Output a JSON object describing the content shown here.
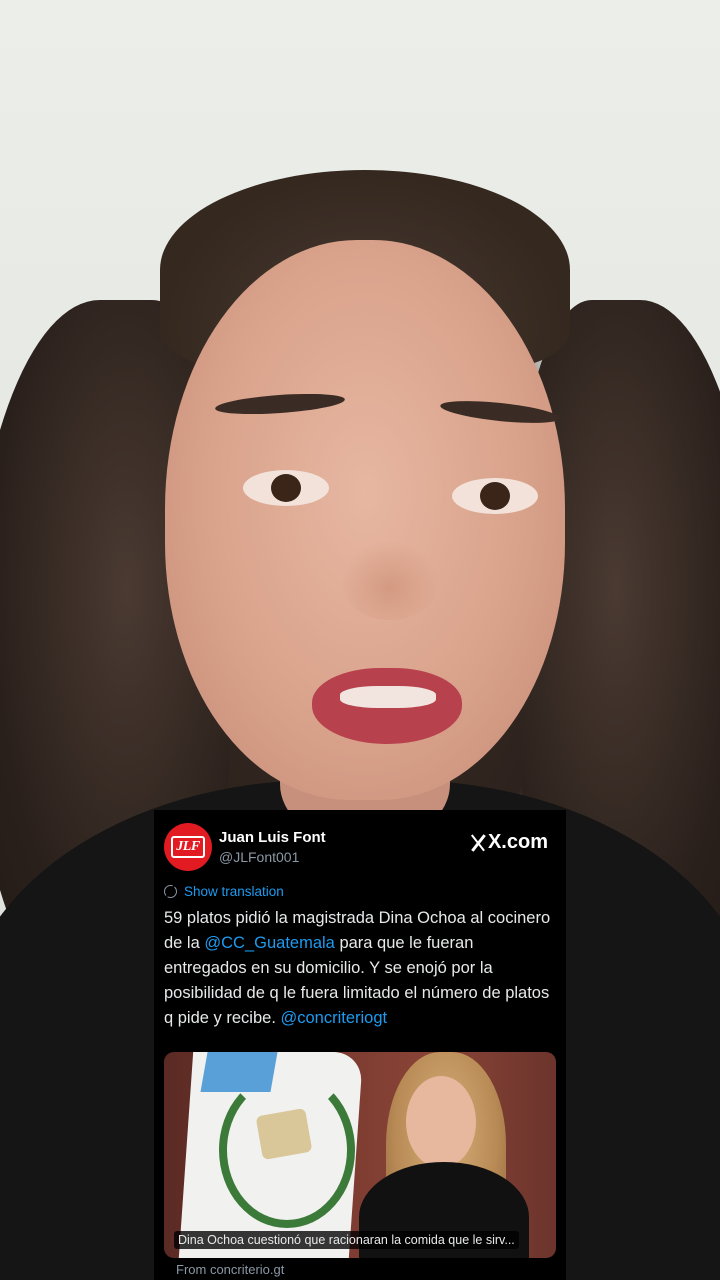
{
  "tweet": {
    "author": {
      "name": "Juan Luis Font",
      "handle": "@JLFont001",
      "avatar_text": "JLF"
    },
    "site_badge": "X.com",
    "translate_link": "Show translation",
    "body": {
      "text1": "59 platos pidió la magistrada Dina Ochoa al cocinero de la ",
      "mention1": "@CC_Guatemala",
      "text2": " para que le fueran entregados en su domicilio. Y se enojó por la posibilidad de q le fuera limitado el número de platos q pide y recibe. ",
      "mention2": "@concriteriogt"
    },
    "media": {
      "caption": "Dina Ochoa cuestionó que racionaran la comida que le sirv..."
    },
    "source": "From concriterio.gt"
  },
  "colors": {
    "card_bg": "#000000",
    "link": "#1d9bf0",
    "secondary_text": "#8b98a5",
    "avatar_bg": "#e21b23"
  },
  "icons": {
    "brand": "x-logo-icon",
    "translate": "globe-icon"
  }
}
